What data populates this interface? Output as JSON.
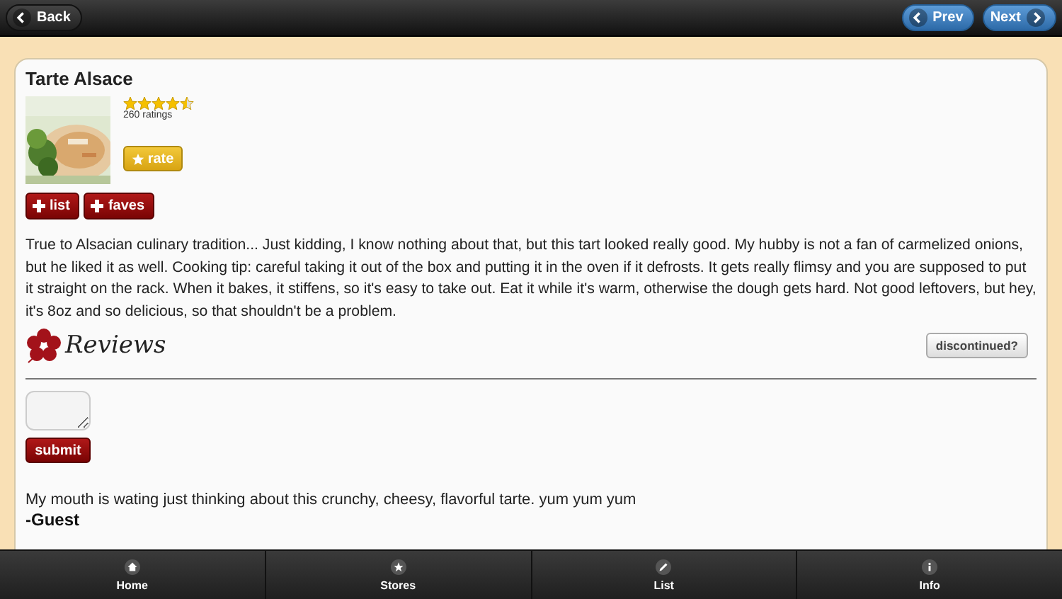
{
  "header": {
    "back": "Back",
    "prev": "Prev",
    "next": "Next"
  },
  "product": {
    "title": "Tarte Alsace",
    "stars": 4.5,
    "ratings": "260 ratings",
    "rate": "rate",
    "list": "list",
    "faves": "faves",
    "description": "True to Alsacian culinary tradition... Just kidding, I know nothing about that, but this tart looked really good. My hubby is not a fan of carmelized onions, but he liked it as well. Cooking tip: careful taking it out of the box and putting it in the oven if it defrosts. It gets really flimsy and you are supposed to put it straight on the rack. When it bakes, it stiffens, so it's easy to take out. Eat it while it's warm, otherwise the dough gets hard. Not good leftovers, but hey, it's 8oz and so delicious, so that shouldn't be a problem."
  },
  "reviews": {
    "heading": "Reviews",
    "discontinued": "discontinued?",
    "submit": "submit",
    "items": [
      {
        "text": "My mouth is wating just thinking about this crunchy, cheesy, flavorful tarte. yum yum yum",
        "author": "-Guest"
      }
    ]
  },
  "tabbar": [
    {
      "label": "Home"
    },
    {
      "label": "Stores"
    },
    {
      "label": "List"
    },
    {
      "label": "Info"
    }
  ]
}
